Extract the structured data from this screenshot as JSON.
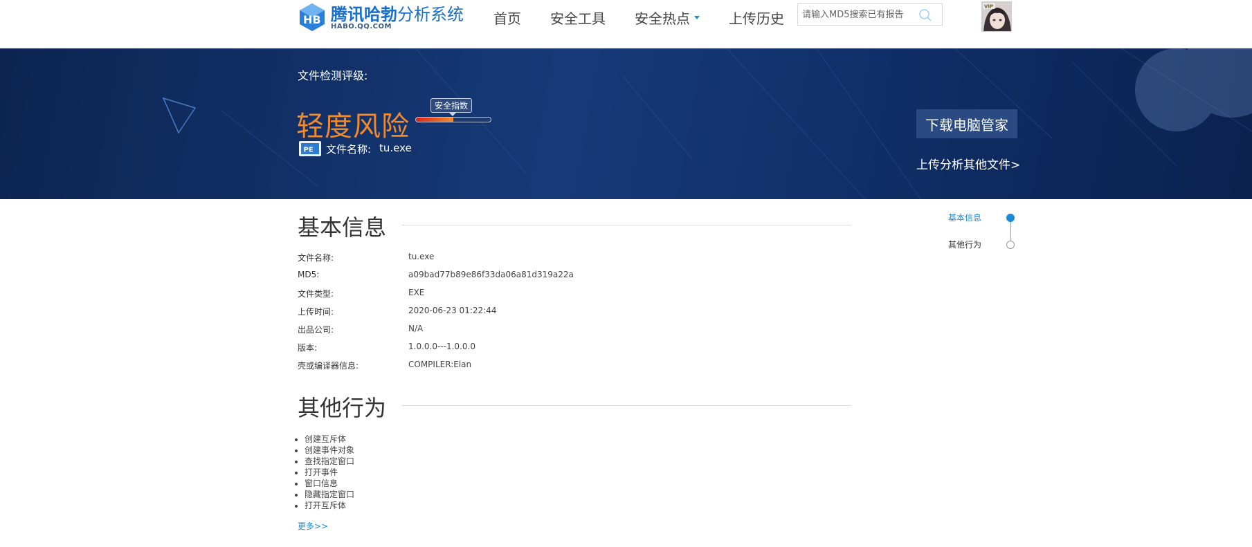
{
  "header": {
    "logo": {
      "brand": "腾讯哈勃",
      "subtitle": "分析系统",
      "domain": "HABO.QQ.COM"
    },
    "nav": [
      {
        "label": "首页",
        "dropdown": false
      },
      {
        "label": "安全工具",
        "dropdown": false
      },
      {
        "label": "安全热点",
        "dropdown": true
      },
      {
        "label": "上传历史",
        "dropdown": false
      }
    ],
    "search": {
      "placeholder": "请输入MD5搜索已有报告",
      "icon": "search-icon"
    },
    "avatar": {
      "badge": "VIP"
    }
  },
  "banner": {
    "rating_label": "文件检测评级:",
    "risk_level": "轻度风险",
    "risk_color": "#f08a2c",
    "safety_index_label": "安全指数",
    "safety_index_fraction": 0.5,
    "file_name_label": "文件名称:",
    "file_name": "tu.exe",
    "file_type_icon": "PE",
    "download_button": "下载电脑管家",
    "upload_other_link": "上传分析其他文件>"
  },
  "basic_info": {
    "title": "基本信息",
    "rows": [
      {
        "key": "文件名称:",
        "value": "tu.exe"
      },
      {
        "key": "MD5:",
        "value": "a09bad77b89e86f33da06a81d319a22a"
      },
      {
        "key": "文件类型:",
        "value": "EXE"
      },
      {
        "key": "上传时间:",
        "value": "2020-06-23 01:22:44"
      },
      {
        "key": "出品公司:",
        "value": "N/A"
      },
      {
        "key": "版本:",
        "value": "1.0.0.0---1.0.0.0"
      },
      {
        "key": "壳或编译器信息:",
        "value": "COMPILER:Elan"
      }
    ]
  },
  "other_behavior": {
    "title": "其他行为",
    "items": [
      "创建互斥体",
      "创建事件对象",
      "查找指定窗口",
      "打开事件",
      "窗口信息",
      "隐藏指定窗口",
      "打开互斥体"
    ],
    "more_link": "更多>>"
  },
  "side_index": {
    "items": [
      {
        "label": "基本信息",
        "active": true
      },
      {
        "label": "其他行为",
        "active": false
      }
    ],
    "active_color": "#1a8bdc"
  }
}
